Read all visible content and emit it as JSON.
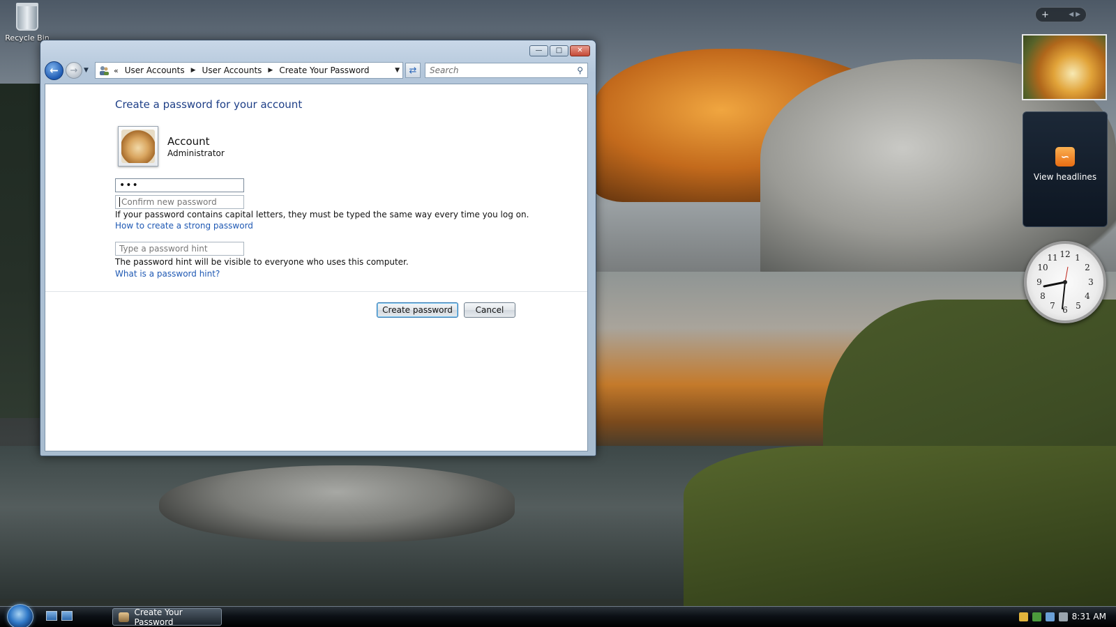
{
  "desktop": {
    "recycle_bin_label": "Recycle Bin"
  },
  "window": {
    "breadcrumb": {
      "prefix": "«",
      "items": [
        "User Accounts",
        "User Accounts",
        "Create Your Password"
      ]
    },
    "search_placeholder": "Search",
    "heading": "Create a password for your account",
    "account": {
      "name": "Account",
      "role": "Administrator"
    },
    "new_password_masked": "•••",
    "confirm_placeholder": "Confirm new password",
    "caps_note": "If your password contains capital letters, they must be typed the same way every time you log on.",
    "strong_link": "How to create a strong password",
    "hint_placeholder": "Type a password hint",
    "hint_note": "The password hint will be visible to everyone who uses this computer.",
    "hint_link": "What is a password hint?",
    "buttons": {
      "create": "Create password",
      "cancel": "Cancel"
    }
  },
  "sidebar": {
    "feed_label": "View headlines"
  },
  "taskbar": {
    "task_label": "Create Your Password",
    "time": "8:31 AM"
  },
  "icons": {
    "back": "back-arrow-icon",
    "forward": "forward-arrow-icon",
    "refresh": "refresh-icon",
    "search": "search-icon",
    "rss": "rss-feed-icon"
  },
  "colors": {
    "link": "#1e58b3",
    "heading": "#1e3f87",
    "close_button": "#c44a36"
  }
}
